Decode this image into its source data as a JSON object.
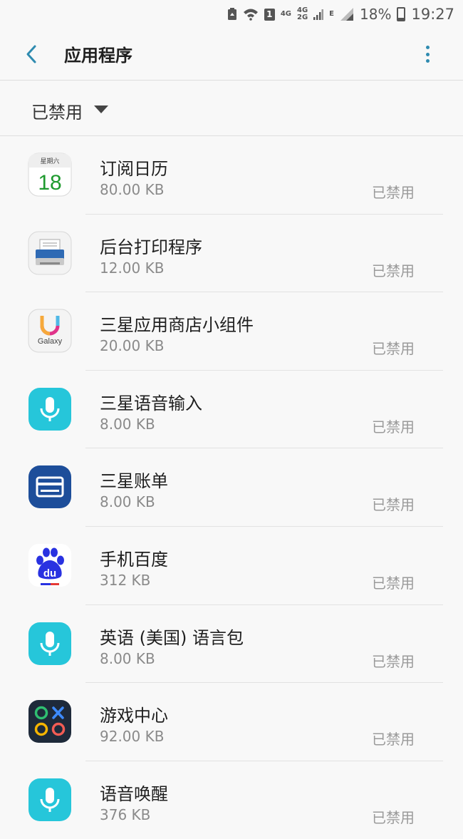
{
  "status_bar": {
    "badge": "1",
    "net_4g": "4G",
    "net_4g2g_top": "4G",
    "net_4g2g_bottom": "2G",
    "net_e": "E",
    "battery": "18%",
    "time": "19:27"
  },
  "app_bar": {
    "title": "应用程序"
  },
  "filter": {
    "selected": "已禁用"
  },
  "calendar_icon": {
    "weekday": "星期六",
    "day": "18"
  },
  "galaxy_icon": {
    "label": "Galaxy"
  },
  "baidu_icon": {
    "label": "du"
  },
  "apps": [
    {
      "name": "订阅日历",
      "size": "80.00 KB",
      "status": "已禁用",
      "icon": "calendar-icon"
    },
    {
      "name": "后台打印程序",
      "size": "12.00 KB",
      "status": "已禁用",
      "icon": "printer-icon"
    },
    {
      "name": "三星应用商店小组件",
      "size": "20.00 KB",
      "status": "已禁用",
      "icon": "galaxy-store-icon"
    },
    {
      "name": "三星语音输入",
      "size": "8.00 KB",
      "status": "已禁用",
      "icon": "microphone-icon"
    },
    {
      "name": "三星账单",
      "size": "8.00 KB",
      "status": "已禁用",
      "icon": "card-icon"
    },
    {
      "name": "手机百度",
      "size": "312 KB",
      "status": "已禁用",
      "icon": "baidu-paw-icon"
    },
    {
      "name": "英语 (美国) 语言包",
      "size": "8.00 KB",
      "status": "已禁用",
      "icon": "microphone-icon"
    },
    {
      "name": "游戏中心",
      "size": "92.00 KB",
      "status": "已禁用",
      "icon": "game-center-icon"
    },
    {
      "name": "语音唤醒",
      "size": "376 KB",
      "status": "已禁用",
      "icon": "microphone-icon"
    }
  ],
  "colors": {
    "accent": "#2f8bb0",
    "mic_teal": "#26c6da",
    "wallet_blue": "#1d4e9a",
    "baidu_blue": "#2932e1",
    "game_dark": "#1e2a3a"
  }
}
